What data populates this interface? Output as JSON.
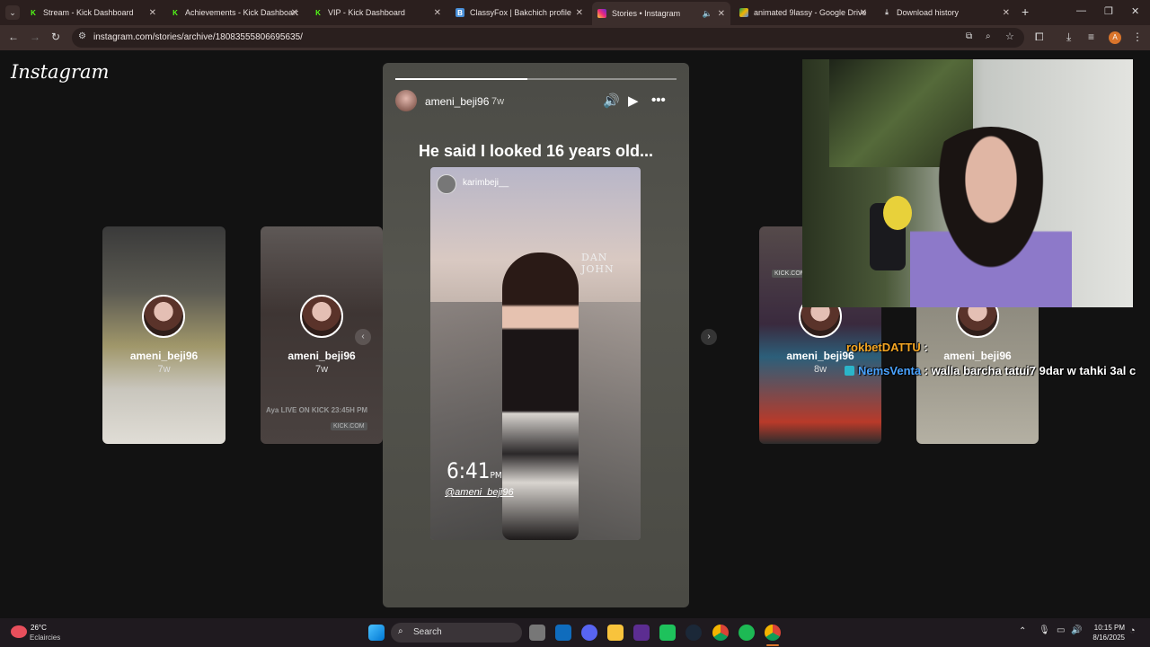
{
  "browser": {
    "tabs": [
      {
        "title": "Stream - Kick Dashboard",
        "favicon": "kick-icon",
        "color": "#53fc18"
      },
      {
        "title": "Achievements - Kick Dashboard",
        "favicon": "kick-icon",
        "color": "#53fc18"
      },
      {
        "title": "VIP - Kick Dashboard",
        "favicon": "kick-icon",
        "color": "#53fc18"
      },
      {
        "title": "ClassyFox | Bakchich profile | Ba",
        "favicon": "profile-icon",
        "color": "#4a90d9"
      },
      {
        "title": "Stories • Instagram",
        "favicon": "instagram-icon",
        "color": "#e1306c"
      },
      {
        "title": "animated 9lassy - Google Drive",
        "favicon": "drive-icon",
        "color": "#f4b400"
      },
      {
        "title": "Download history",
        "favicon": "download-icon",
        "color": "#cccccc"
      }
    ],
    "active_tab": 4,
    "url": "instagram.com/stories/archive/18083555806695635/"
  },
  "instagram": {
    "logo": "Instagram",
    "story": {
      "username": "ameni_beji96",
      "time": "7w",
      "progress": 0.47,
      "caption": "He said I looked 16 years old...",
      "photo_user": "karimbeji__",
      "sign": "DAN JOHN",
      "clock": "6:41",
      "clock_suffix": "PM",
      "handle": "@ameni_beji96"
    },
    "thumbs": [
      {
        "username": "ameni_beji96",
        "time": "7w"
      },
      {
        "username": "ameni_beji96",
        "time": "7w",
        "overlay": "Aya LIVE ON KICK 23:45H PM",
        "badge": "KICK.COM"
      },
      {
        "username": "ameni_beji96",
        "time": "8w",
        "badge": "KICK.COM"
      },
      {
        "username": "ameni_beji96",
        "time": ""
      }
    ]
  },
  "chat": [
    {
      "user": "rokbetDATTU",
      "message": ":",
      "user_color": "#f5a623"
    },
    {
      "user": "NemsVenta",
      "message": ": walla barcha tatui7 9dar w tahki 3al c",
      "user_color": "#4aa3ff"
    }
  ],
  "taskbar": {
    "weather_temp": "26°C",
    "weather_desc": "Eclaircies",
    "search_placeholder": "Search",
    "time": "10:15 PM",
    "date": "8/16/2025"
  }
}
